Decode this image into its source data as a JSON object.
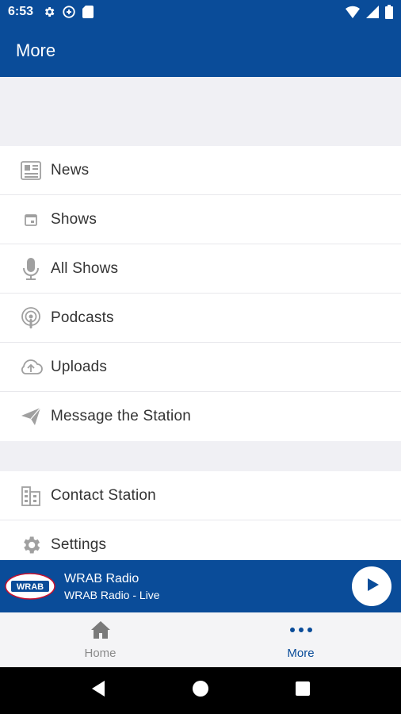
{
  "status_bar": {
    "time": "6:53"
  },
  "app_bar": {
    "title": "More"
  },
  "menu_group_1": [
    {
      "label": "News",
      "icon": "newspaper-icon"
    },
    {
      "label": "Shows",
      "icon": "calendar-icon"
    },
    {
      "label": "All Shows",
      "icon": "microphone-icon"
    },
    {
      "label": "Podcasts",
      "icon": "podcast-icon"
    },
    {
      "label": "Uploads",
      "icon": "cloud-upload-icon"
    },
    {
      "label": "Message the Station",
      "icon": "send-icon"
    }
  ],
  "menu_group_2": [
    {
      "label": "Contact Station",
      "icon": "building-icon"
    },
    {
      "label": "Settings",
      "icon": "gear-icon"
    }
  ],
  "player": {
    "logo_text": "WRAB",
    "title": "WRAB Radio",
    "subtitle": "WRAB Radio - Live"
  },
  "bottom_nav": {
    "home_label": "Home",
    "more_label": "More"
  },
  "colors": {
    "primary": "#0a4c99",
    "background": "#f0f0f4",
    "icon_gray": "#9a9a9a"
  }
}
